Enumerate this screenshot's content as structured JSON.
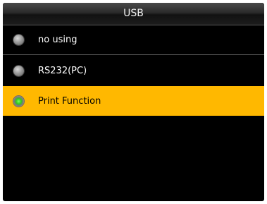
{
  "window": {
    "title": "USB"
  },
  "options": [
    {
      "label": "no using",
      "selected": false
    },
    {
      "label": "RS232(PC)",
      "selected": false
    },
    {
      "label": "Print Function",
      "selected": true
    }
  ],
  "colors": {
    "selection_highlight": "#ffb800",
    "selected_indicator": "#33c91c",
    "background": "#000000"
  }
}
